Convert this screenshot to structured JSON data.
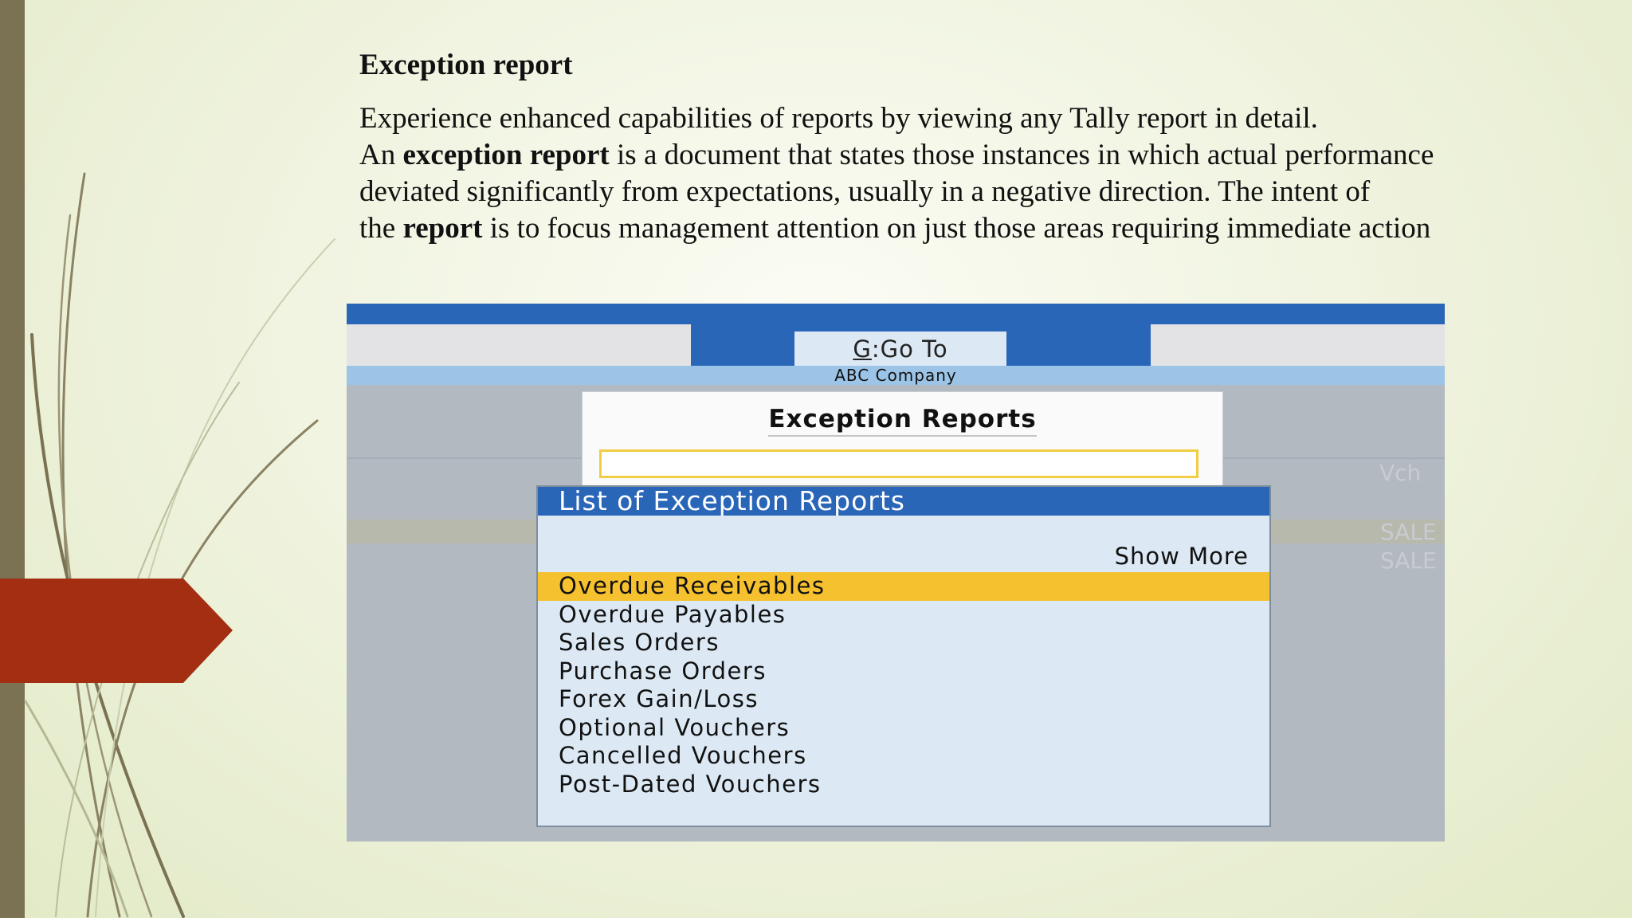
{
  "slide": {
    "title": "Exception report",
    "line1": "Experience enhanced capabilities of reports by viewing any Tally report in detail.",
    "line2_pre": "An ",
    "line2_bold": "exception report",
    "line2_post": " is a document that states those instances in which actual performance",
    "line3": "deviated significantly from expectations, usually in a negative direction. The intent of",
    "line4_pre": "the ",
    "line4_bold": "report",
    "line4_post": " is to focus management attention on just those areas requiring immediate action"
  },
  "tally": {
    "goto_key": "G",
    "goto_label": ":Go To",
    "company": "ABC Company",
    "panel_title": "Exception Reports",
    "bg_vch": "Vch",
    "bg_sale1": "SALE",
    "bg_sale2": "SALE",
    "list_title": "List of Exception Reports",
    "show_more": "Show More",
    "items": [
      "Overdue Receivables",
      "Overdue Payables",
      "Sales Orders",
      "Purchase Orders",
      "Forex Gain/Loss",
      "Optional Vouchers",
      "Cancelled Vouchers",
      "Post-Dated Vouchers"
    ],
    "selected_item": "Overdue Receivables"
  },
  "colors": {
    "accent_red": "#a32e12",
    "sidebar": "#7a7252",
    "tally_blue": "#2a66b8",
    "highlight": "#f6c12e"
  }
}
